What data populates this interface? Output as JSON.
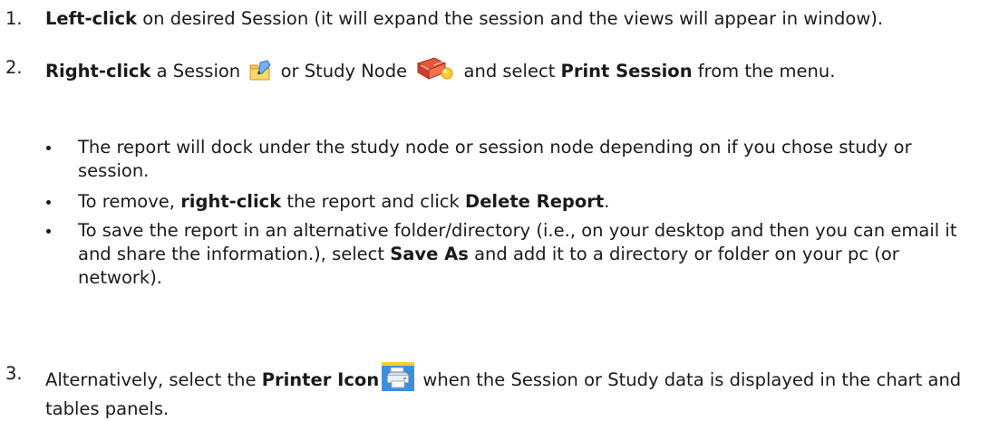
{
  "steps": [
    {
      "number": "1.",
      "bold1": "Left-click",
      "text1": " on desired Session (it will expand the session and the views will appear in window)."
    },
    {
      "number": "2.",
      "bold1": "Right-click",
      "text1": " a Session ",
      "text2": " or Study Node ",
      "text3": " and select ",
      "bold2": "Print Session",
      "text4": " from the menu."
    },
    {
      "number": "3.",
      "text1": "Alternatively, select the ",
      "bold1": "Printer Icon",
      "text2": " when the Session or Study data is displayed in the chart and tables panels."
    }
  ],
  "bullets": [
    {
      "text1": "The report will dock under the study node or session node depending on if you chose study or session."
    },
    {
      "text1": "To remove, ",
      "bold1": "right-click",
      "text2": " the report and click ",
      "bold2": "Delete Report",
      "text3": "."
    },
    {
      "text1": "To save the report in an alternative folder/directory (i.e., on your desktop and then you can email it and share the information.), select ",
      "bold1": "Save As",
      "text2": " and add it to a directory or folder on your pc (or network)."
    }
  ],
  "icons": {
    "session": "session-folder-icon",
    "study_node": "study-node-icon",
    "printer": "printer-icon"
  }
}
